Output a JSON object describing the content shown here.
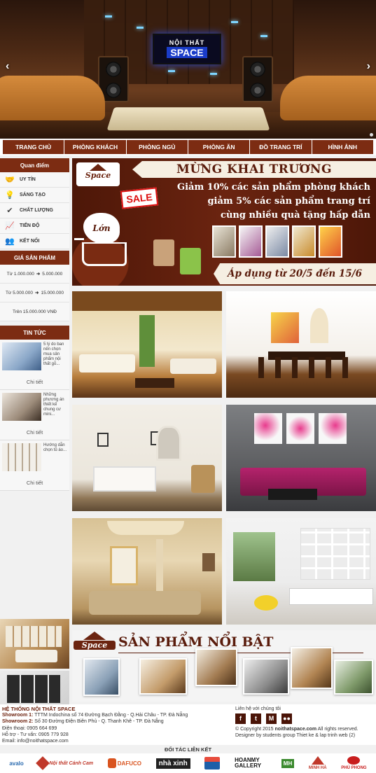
{
  "hero": {
    "tv_line1": "NỘI THẤT",
    "tv_line2": "SPACE",
    "prev_arrow": "‹",
    "next_arrow": "›"
  },
  "nav": {
    "items": [
      "TRANG CHỦ",
      "PHÒNG KHÁCH",
      "PHÒNG NGỦ",
      "PHÒNG ĂN",
      "ĐỒ TRANG TRÍ",
      "HÌNH ẢNH"
    ]
  },
  "sidebar": {
    "quan_diem_title": "Quan điểm",
    "quan_diem": [
      {
        "label": "UY TÍN",
        "icon": "handshake-icon"
      },
      {
        "label": "SÁNG TẠO",
        "icon": "lightbulb-icon"
      },
      {
        "label": "CHẤT LƯỢNG",
        "icon": "check-circle-icon"
      },
      {
        "label": "TIẾN ĐỘ",
        "icon": "chart-line-icon"
      },
      {
        "label": "KẾT NỐI",
        "icon": "users-icon"
      }
    ],
    "gia_title": "GIÁ SẢN PHẨM",
    "prices": [
      {
        "from": "Từ 1.000.000",
        "to": "5.000.000"
      },
      {
        "from": "Từ 5.000.000",
        "to": "15.000.000"
      },
      {
        "from": "Trên 15.000.000 VNĐ",
        "to": ""
      }
    ],
    "tin_tuc_title": "TIN TỨC",
    "news": [
      {
        "text": "5 lý do ban nên chọn mua sản phẩm nội thất gỗ...",
        "more": "Chi tiết"
      },
      {
        "text": "Những phương án thiết kế chung cư mini...",
        "more": "Chi tiết"
      },
      {
        "text": "Hướng dẫn chọn tủ áo...",
        "more": "Chi tiết"
      }
    ]
  },
  "banner": {
    "logo": "Space",
    "title": "MỪNG KHAI TRƯƠNG",
    "sale": "SALE",
    "line1": "Giảm 10% các sản phẩm phòng khách",
    "line2": "giảm 5% các sản phẩm trang trí",
    "line3": "cùng nhiều quà tặng hấp dẫn",
    "splash": "Lớn",
    "date": "Áp dụng từ 20/5 đến 15/6"
  },
  "featured": {
    "logo": "Space",
    "title": "SẢN PHẨM NỔI BẬT"
  },
  "footer": {
    "heading": "HỆ THỐNG NỘI THẤT SPACE",
    "showroom1_label": "Showroom 1:",
    "showroom1": "TTTM Indochina số 74 Đường Bạch Đằng - Q.Hải Châu - TP. Đà Nẵng",
    "showroom2_label": "Showroom 2:",
    "showroom2": "Số 30 Đường Điện Biên Phủ - Q. Thanh Khê - TP. Đà Nẵng",
    "phone": "Điện thoại: 0905 664 699",
    "support": "Hỗ trợ - Tư vấn:   0905 779 928",
    "email": "Email: info@noithatspace.com",
    "contact_title": "Liên hệ với chúng tôi",
    "social": [
      {
        "glyph": "f",
        "icon": "facebook-icon"
      },
      {
        "glyph": "t",
        "icon": "twitter-icon"
      },
      {
        "glyph": "M",
        "icon": "gmail-icon"
      },
      {
        "glyph": "●●",
        "icon": "flickr-icon"
      }
    ],
    "copyright_prefix": "© Copyright 2015 ",
    "copyright_site": "noithatspace.com",
    "copyright_suffix": " All rights reserved.",
    "designer": "Designer by students group Thiet ke & lap trinh web (2)",
    "partners_title": "ĐỐI TÁC LIÊN KẾT",
    "partners": [
      {
        "name": "avalo",
        "color": "#2a6bb0"
      },
      {
        "name": "Nội thất Cánh Cam",
        "color": "#c0392b"
      },
      {
        "name": "DAFUCO",
        "color": "#d9541f"
      },
      {
        "name": "nhà xinh",
        "color": "#222222"
      },
      {
        "name": "",
        "color": "#1d5fa8"
      },
      {
        "name": "HOANMY GALLERY",
        "color": "#111111"
      },
      {
        "name": "MH",
        "color": "#3b8a2e"
      },
      {
        "name": "MINH HÀ",
        "color": "#c0392b"
      },
      {
        "name": "PHÚ PHONG",
        "color": "#c81d1d"
      }
    ]
  }
}
